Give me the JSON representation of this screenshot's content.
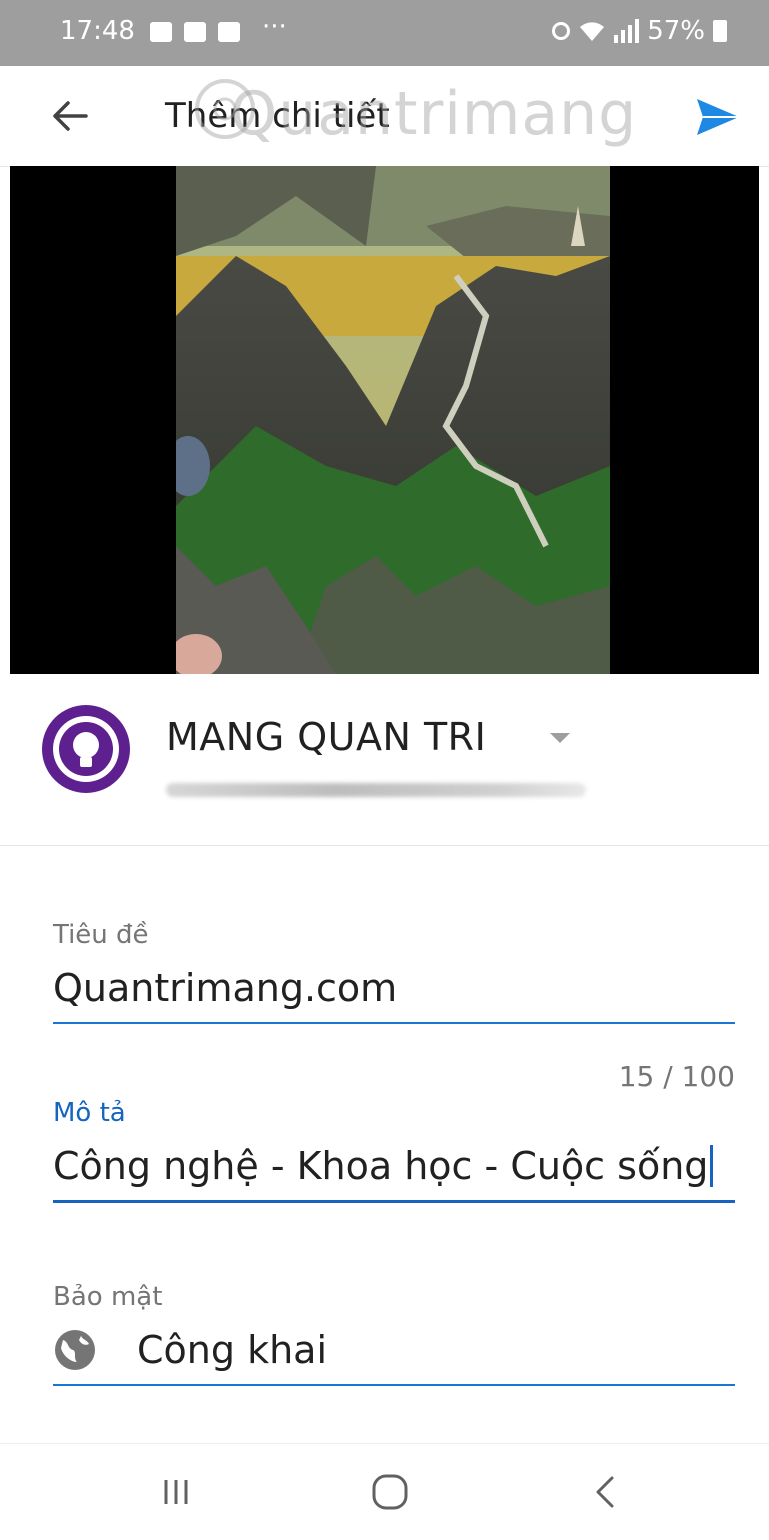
{
  "status_bar": {
    "time": "17:48",
    "overflow": "···",
    "battery": "57%"
  },
  "app_bar": {
    "title": "Thêm chi tiết",
    "watermark": "Quantrimang"
  },
  "account": {
    "name": "MANG QUAN TRI"
  },
  "fields": {
    "title": {
      "label": "Tiêu đề",
      "value": "Quantrimang.com",
      "counter": "15 / 100"
    },
    "description": {
      "label": "Mô tả",
      "value": "Công nghệ - Khoa học - Cuộc sống"
    },
    "privacy": {
      "label": "Bảo mật",
      "value": "Công khai"
    }
  },
  "colors": {
    "accent": "#1565c0",
    "send": "#1e88e5",
    "avatar": "#5e1f8f",
    "status_bar": "#9e9e9e"
  },
  "icons": [
    "back-arrow-icon",
    "send-icon",
    "globe-icon",
    "recents-icon",
    "home-icon",
    "nav-back-icon"
  ]
}
